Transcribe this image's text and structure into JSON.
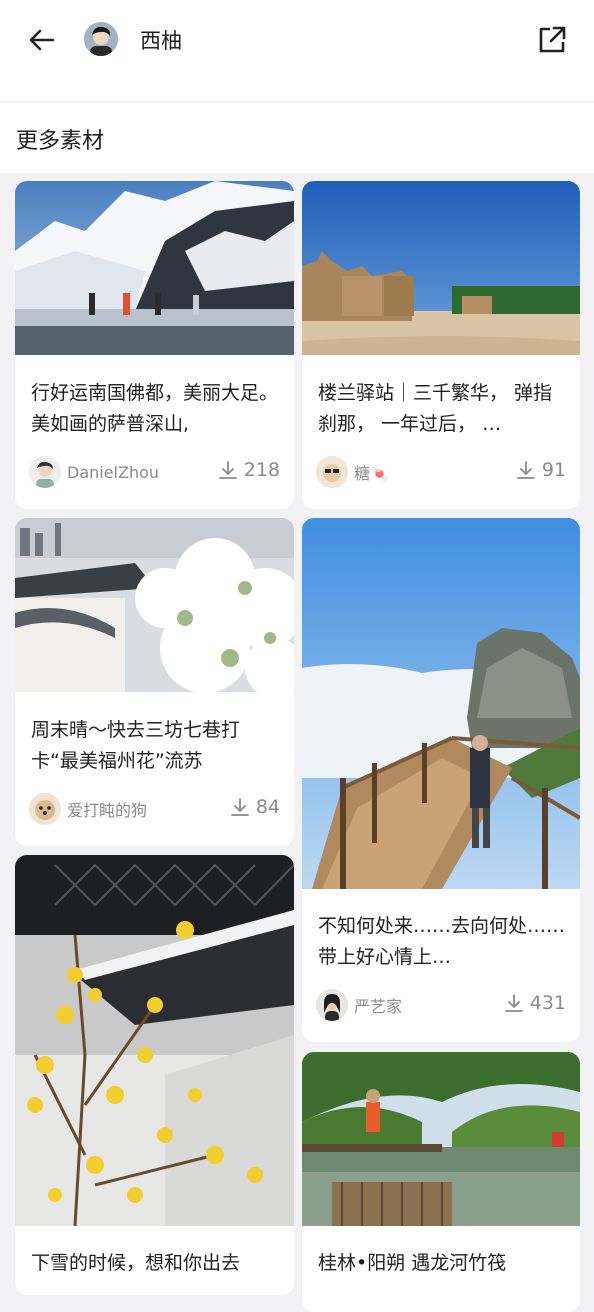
{
  "header": {
    "title": "西柚",
    "back_icon": "arrow-left-icon",
    "share_icon": "external-share-icon"
  },
  "section": {
    "title": "更多素材"
  },
  "cards": [
    {
      "title": "行好运南国佛都，美丽大足。美如画的萨普深山,",
      "user": "DanielZhou",
      "downloads": "218"
    },
    {
      "title": "楼兰驿站｜三千繁华， 弹指刹那， 一年过后， …",
      "user": "糖🍬",
      "downloads": "91"
    },
    {
      "title": "周末晴～快去三坊七巷打卡“最美福州花”流苏",
      "user": "爱打盹的狗",
      "downloads": "84"
    },
    {
      "title": "不知何处来……去向何处……带上好心情上…",
      "user": "严艺家",
      "downloads": "431"
    },
    {
      "title": "下雪的时候，想和你出去",
      "user": "",
      "downloads": ""
    },
    {
      "title": "桂林•阳朔 遇龙河竹筏",
      "user": "",
      "downloads": ""
    }
  ],
  "colors": {
    "background": "#f2f2f4",
    "card": "#ffffff",
    "muted_text": "#8a8a8a"
  }
}
